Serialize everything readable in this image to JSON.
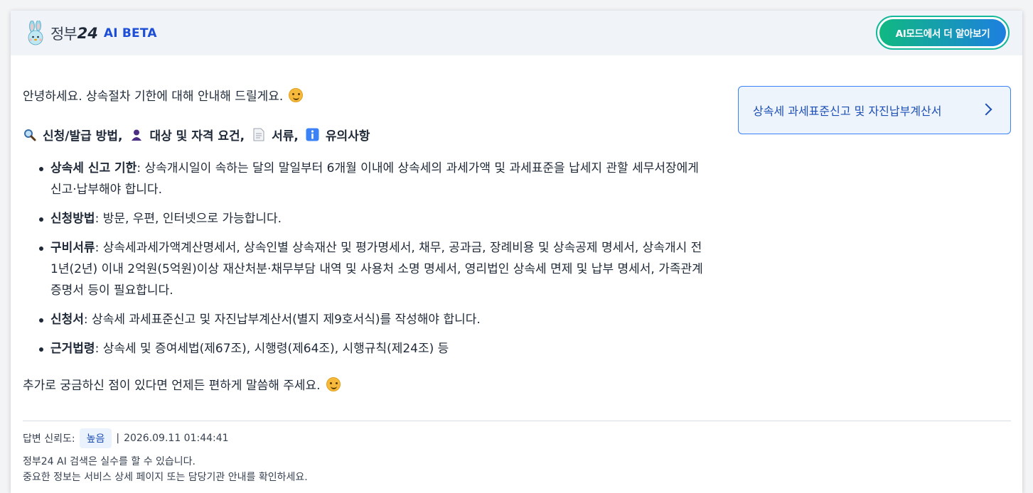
{
  "header": {
    "logo_text": "정부",
    "logo_num": "24",
    "logo_ai": "AI BETA",
    "aimode_button": "AI모드에서 더 알아보기"
  },
  "answer": {
    "greeting": "안녕하세요. 상속절차 기한에 대해 안내해 드릴게요.",
    "categories": [
      {
        "icon": "magnifier-icon",
        "label": "신청/발급 방법,"
      },
      {
        "icon": "person-icon",
        "label": "대상 및 자격 요건,"
      },
      {
        "icon": "document-icon",
        "label": "서류,"
      },
      {
        "icon": "info-icon",
        "label": "유의사항"
      }
    ],
    "items": [
      {
        "title": "상속세 신고 기한",
        "text": ": 상속개시일이 속하는 달의 말일부터 6개월 이내에 상속세의 과세가액 및 과세표준을 납세지 관할 세무서장에게 신고·납부해야 합니다."
      },
      {
        "title": "신청방법",
        "text": ": 방문, 우편, 인터넷으로 가능합니다."
      },
      {
        "title": "구비서류",
        "text": ": 상속세과세가액계산명세서, 상속인별 상속재산 및 평가명세서, 채무, 공과금, 장례비용 및 상속공제 명세서, 상속개시 전 1년(2년) 이내 2억원(5억원)이상 재산처분·채무부담 내역 및 사용처 소명 명세서, 영리법인 상속세 면제 및 납부 명세서, 가족관계증명서 등이 필요합니다."
      },
      {
        "title": "신청서",
        "text": ": 상속세 과세표준신고 및 자진납부계산서(별지 제9호서식)를 작성해야 합니다."
      },
      {
        "title": "근거법령",
        "text": ": 상속세 및 증여세법(제67조), 시행령(제64조), 시행규칙(제24조) 등"
      }
    ],
    "followup": "추가로 궁금하신 점이 있다면 언제든 편하게 말씀해 주세요."
  },
  "related": {
    "label": "상속세 과세표준신고 및 자진납부계산서"
  },
  "footer": {
    "reliability_label": "답변 신뢰도:",
    "reliability_value": "높음",
    "separator": "|",
    "timestamp": "2026.09.11 01:44:41",
    "note_line1": "정부24 AI 검색은 실수를 할 수 있습니다.",
    "note_line2": "중요한 정보는 서비스 상세 페이지 또는 담당기관 안내를 확인하세요."
  },
  "colors": {
    "brand_blue": "#1d4ed8",
    "accent_green": "#10b981",
    "header_bg": "#f0f3f7"
  }
}
